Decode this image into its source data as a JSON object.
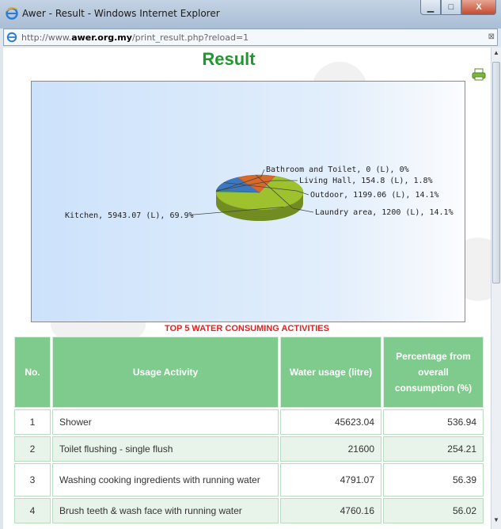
{
  "window": {
    "title": "Awer - Result - Windows Internet Explorer",
    "close_glyph": "X",
    "min_glyph": "▁",
    "max_glyph": "□"
  },
  "address": {
    "prefix": "http://www.",
    "domain": "awer.org.my",
    "path": "/print_result.php?reload=1",
    "right_glyph": "⊠"
  },
  "page": {
    "title": "Result",
    "top5_heading": "TOP 5 WATER CONSUMING ACTIVITIES"
  },
  "colors": {
    "title_green": "#1e9a2c",
    "table_header": "#7fcb8d",
    "heading_red": "#e52020"
  },
  "chart_data": {
    "type": "pie",
    "labels": [
      "Kitchen",
      "Bathroom and Toilet",
      "Living Hall",
      "Outdoor",
      "Laundry area"
    ],
    "values": [
      5943.07,
      0,
      154.8,
      1199.06,
      1200
    ],
    "percent": [
      69.9,
      0,
      1.8,
      14.1,
      14.1
    ],
    "display_labels": [
      "Kitchen, 5943.07 (L), 69.9%",
      "Bathroom and Toilet, 0 (L), 0%",
      "Living Hall, 154.8 (L), 1.8%",
      "Outdoor, 1199.06 (L), 14.1%",
      "Laundry area, 1200 (L), 14.1%"
    ],
    "colors": [
      "#9dc22e",
      "#5a7fc2",
      "#2a8c8c",
      "#3b78c0",
      "#d8692a"
    ]
  },
  "table": {
    "headers": [
      "No.",
      "Usage Activity",
      "Water usage (litre)",
      "Percentage from overall consumption (%)"
    ],
    "rows": [
      {
        "no": "1",
        "activity": "Shower",
        "usage": "45623.04",
        "percent": "536.94"
      },
      {
        "no": "2",
        "activity": "Toilet flushing - single flush",
        "usage": "21600",
        "percent": "254.21"
      },
      {
        "no": "3",
        "activity": "Washing cooking ingredients with running water",
        "usage": "4791.07",
        "percent": "56.39"
      },
      {
        "no": "4",
        "activity": "Brush teeth & wash face with running water",
        "usage": "4760.16",
        "percent": "56.02"
      }
    ]
  }
}
